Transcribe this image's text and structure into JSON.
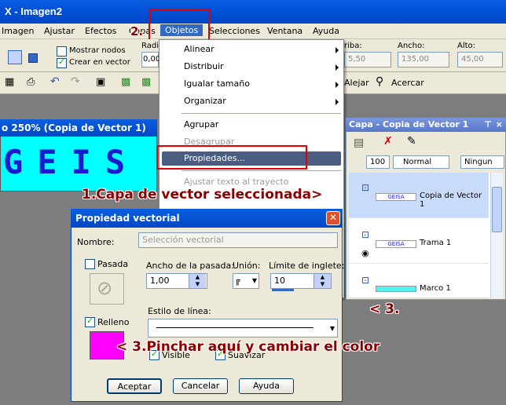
{
  "app": {
    "title": "X - Imagen2"
  },
  "menubar": {
    "items": [
      "Imagen",
      "Ajustar",
      "Efectos",
      "Capas",
      "Objetos",
      "Selecciones",
      "Ventana",
      "Ayuda"
    ],
    "step_label": "2."
  },
  "tool_options": {
    "mostrar_nodos": "Mostrar nodos",
    "crear_vector": "Crear en vector",
    "radio_label": "Radio",
    "radio_value": "0,00",
    "ancho_label": "Ancho:",
    "ancho_value": "135,00",
    "alto_label": "Alto:",
    "alto_value": "45,00",
    "arriba_label": "riba:",
    "arriba_value": "5,50",
    "alejar": "Alejar",
    "acercar": "Acercar"
  },
  "document": {
    "title": "o 250% (Copia de Vector 1)",
    "canvas_text": "GEIS"
  },
  "objetos_menu": {
    "items": [
      {
        "label": "Alinear",
        "submenu": true
      },
      {
        "label": "Distribuir",
        "submenu": true
      },
      {
        "label": "Igualar tamaño",
        "submenu": true
      },
      {
        "label": "Organizar",
        "submenu": true
      },
      {
        "label": "Agrupar",
        "submenu": false
      },
      {
        "label": "Desagrupar",
        "submenu": false
      },
      {
        "label": "Propiedades...",
        "submenu": false
      },
      {
        "label": "Ajustar texto al trayecto",
        "submenu": false
      }
    ]
  },
  "layers_panel": {
    "title": "Capa - Copia de Vector 1",
    "opacity": "100",
    "blend": "Normal",
    "mask": "Ningun",
    "layers": [
      {
        "name": "Copia de Vector 1",
        "thumb": "GEISA"
      },
      {
        "name": "Trama 1",
        "thumb": "GEISA"
      },
      {
        "name": "Marco 1",
        "thumb": ""
      }
    ]
  },
  "annotations": {
    "one": "1.Capa de vector seleccionada>",
    "three_panel": "< 3.",
    "three_color": "< 3.Pinchar aquí y cambiar el color"
  },
  "dialog": {
    "title": "Propiedad vectorial",
    "nombre_label": "Nombre:",
    "nombre_value": "Selección vectorial",
    "pasada": "Pasada",
    "relleno": "Relleno",
    "ancho_pasada_label": "Ancho de la pasada:",
    "ancho_pasada_value": "1,00",
    "union_label": "Unión:",
    "limite_label": "Límite de inglete:",
    "limite_value": "10",
    "estilo_label": "Estilo de línea:",
    "visible": "Visible",
    "suavizar": "Suavizar",
    "ok": "Aceptar",
    "cancel": "Cancelar",
    "help": "Ayuda",
    "fill_color": "#ff00ff"
  },
  "colors": {
    "accent_red": "#e00000",
    "annotation_text": "#8b0000",
    "canvas_bg": "#00ffff",
    "canvas_text": "#1a1ad0"
  }
}
